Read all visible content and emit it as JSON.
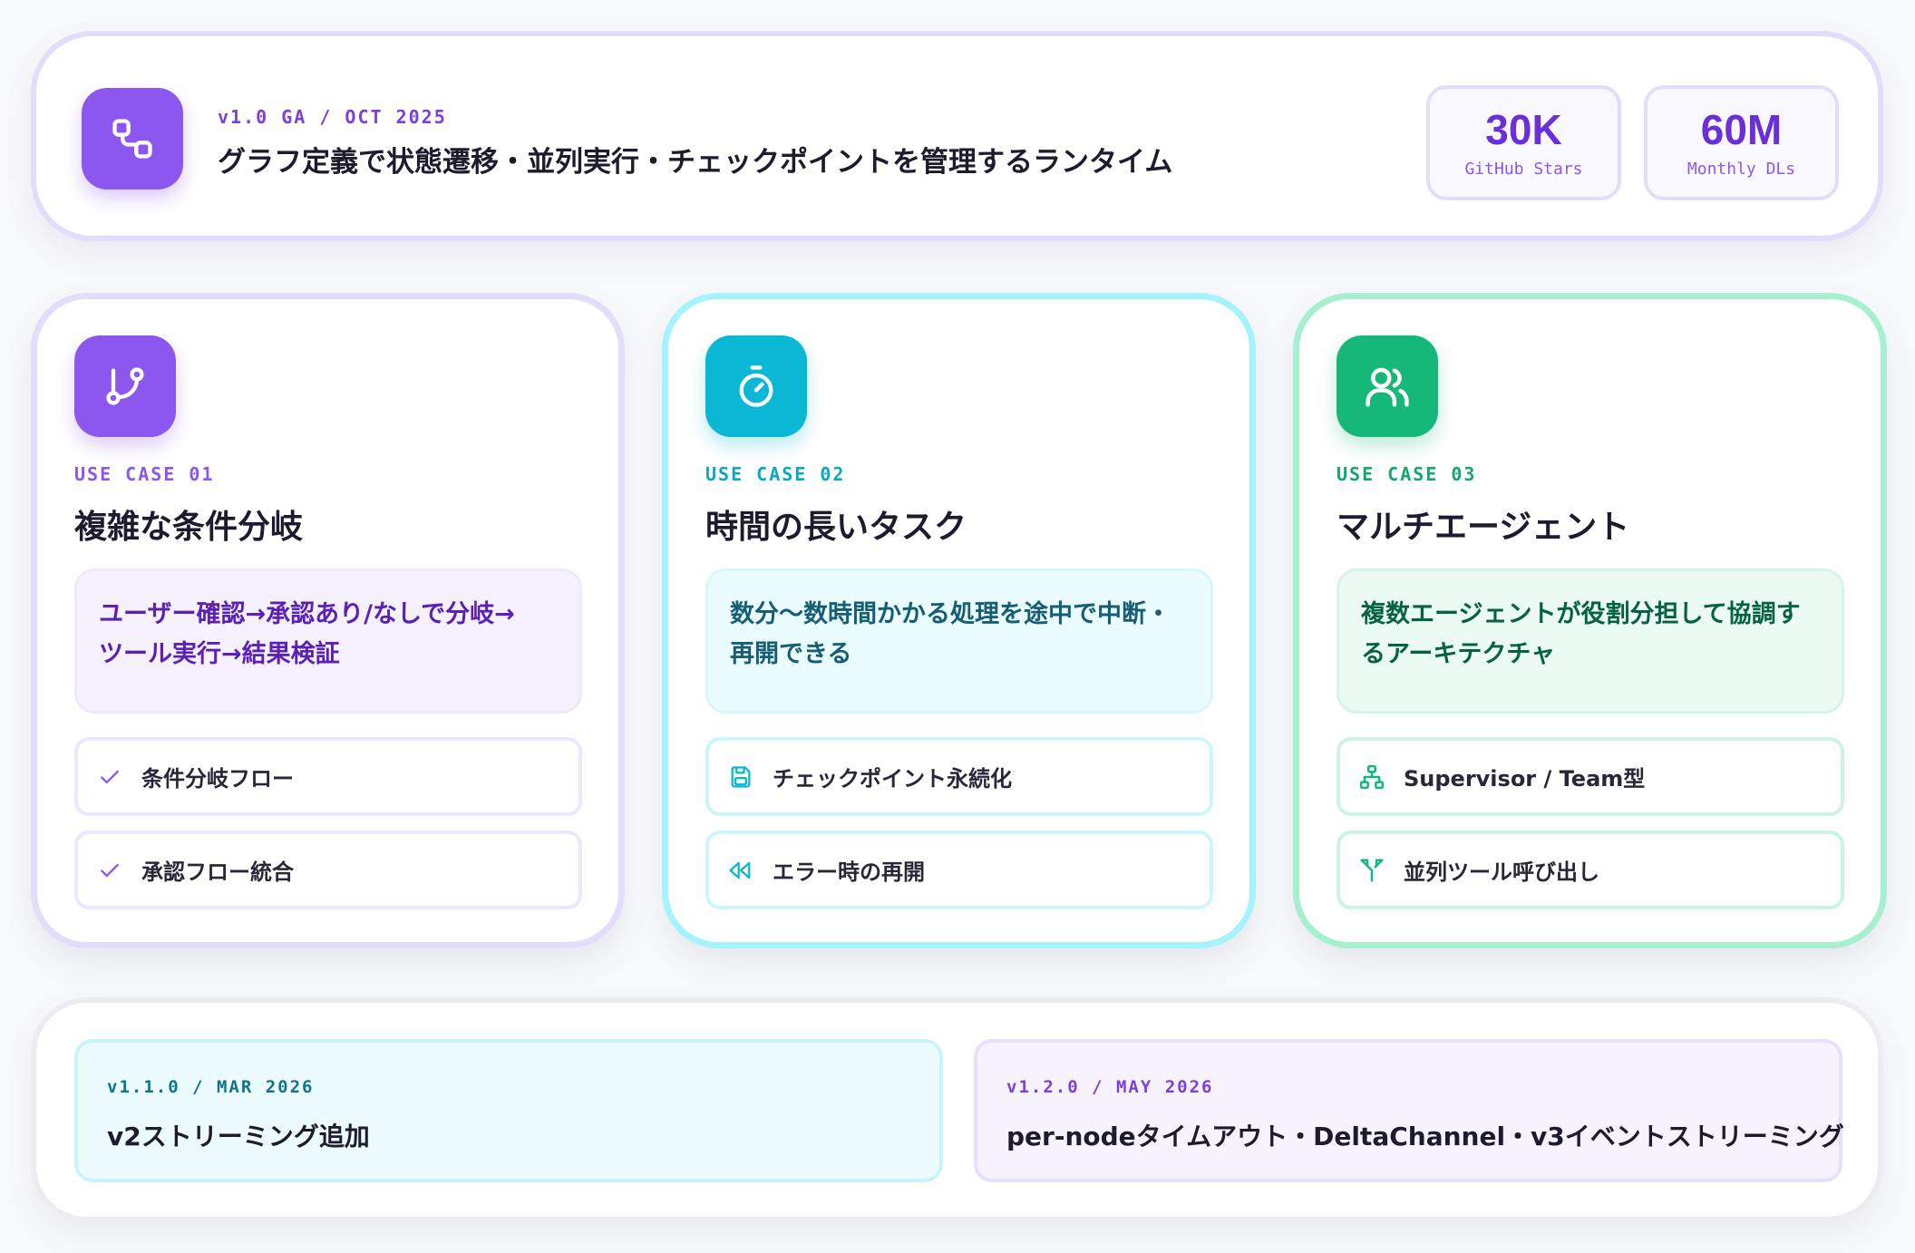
{
  "header": {
    "tag": "v1.0 GA / OCT 2025",
    "title": "グラフ定義で状態遷移・並列実行・チェックポイントを管理するランタイム",
    "logo_icon": "graph-nodes-icon",
    "stats": [
      {
        "value": "30K",
        "label": "GitHub Stars"
      },
      {
        "value": "60M",
        "label": "Monthly DLs"
      }
    ]
  },
  "use_cases": [
    {
      "tag": "USE CASE 01",
      "title": "複雑な条件分岐",
      "icon": "git-branch-icon",
      "accent": "#8b57ee",
      "desc_line1": "ユーザー確認→承認あり/なしで分岐→",
      "desc_line2": "ツール実行→結果検証",
      "features": [
        {
          "icon": "check-icon",
          "label": "条件分岐フロー"
        },
        {
          "icon": "check-icon",
          "label": "承認フロー統合"
        }
      ]
    },
    {
      "tag": "USE CASE 02",
      "title": "時間の長いタスク",
      "icon": "stopwatch-icon",
      "accent": "#0ab8d6",
      "desc_line1": "数分〜数時間かかる処理を途中で中断・",
      "desc_line2": "再開できる",
      "features": [
        {
          "icon": "save-icon",
          "label": "チェックポイント永続化"
        },
        {
          "icon": "rewind-icon",
          "label": "エラー時の再開"
        }
      ]
    },
    {
      "tag": "USE CASE 03",
      "title": "マルチエージェント",
      "icon": "users-icon",
      "accent": "#16b87a",
      "desc_line1": "複数エージェントが役割分担して協調す",
      "desc_line2": "るアーキテクチャ",
      "features": [
        {
          "icon": "hierarchy-icon",
          "label": "Supervisor / Team型"
        },
        {
          "icon": "split-icon",
          "label": "並列ツール呼び出し"
        }
      ]
    }
  ],
  "versions": [
    {
      "tag": "v1.1.0 / MAR 2026",
      "title": "v2ストリーミング追加"
    },
    {
      "tag": "v1.2.0 / MAY 2026",
      "title": "per-nodeタイムアウト・DeltaChannel・v3イベントストリーミング"
    }
  ]
}
